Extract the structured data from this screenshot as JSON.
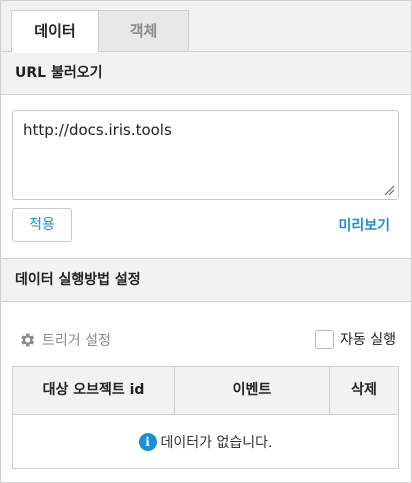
{
  "tabs": [
    {
      "label": "데이터",
      "active": true
    },
    {
      "label": "객체",
      "active": false
    }
  ],
  "url_section": {
    "title": "URL 불러오기",
    "url_value": "http://docs.iris.tools",
    "apply_label": "적용",
    "preview_label": "미리보기"
  },
  "exec_section": {
    "title": "데이터 실행방법 설정",
    "trigger_label": "트리거 설정",
    "auto_run_label": "자동 실행",
    "auto_run_checked": false
  },
  "table": {
    "columns": [
      "대상 오브젝트 id",
      "이벤트",
      "삭제"
    ],
    "empty_message": "데이터가 없습니다."
  },
  "colors": {
    "accent": "#1a8fd6",
    "muted": "#8a8a8a"
  },
  "icons": {
    "trigger": "gear-icon",
    "empty": "info-icon"
  }
}
